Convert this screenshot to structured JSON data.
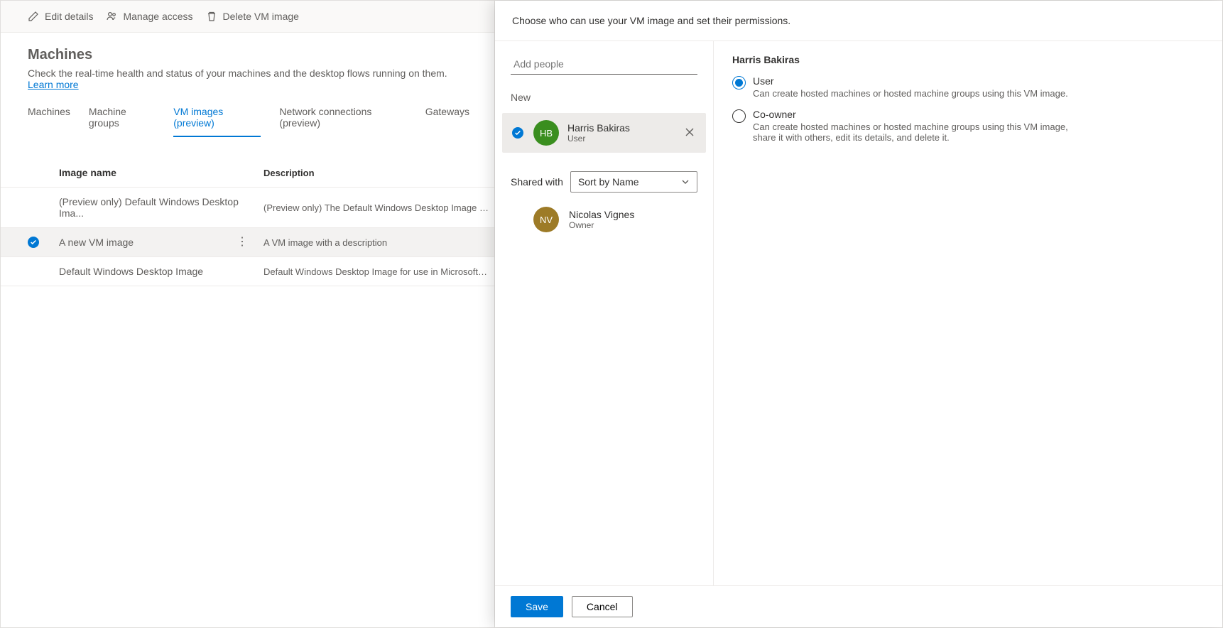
{
  "commandBar": {
    "edit": "Edit details",
    "manage": "Manage access",
    "delete": "Delete VM image"
  },
  "page": {
    "title": "Machines",
    "subtitle": "Check the real-time health and status of your machines and the desktop flows running on them. ",
    "learnMore": "Learn more"
  },
  "tabs": [
    {
      "label": "Machines"
    },
    {
      "label": "Machine groups"
    },
    {
      "label": "VM images (preview)",
      "active": true
    },
    {
      "label": "Network connections (preview)"
    },
    {
      "label": "Gateways"
    }
  ],
  "table": {
    "headers": {
      "name": "Image name",
      "desc": "Description"
    },
    "rows": [
      {
        "name": "(Preview only) Default Windows Desktop Ima...",
        "desc": "(Preview only) The Default Windows Desktop Image for use i...",
        "selected": false
      },
      {
        "name": "A new VM image",
        "desc": "A VM image with a description",
        "selected": true
      },
      {
        "name": "Default Windows Desktop Image",
        "desc": "Default Windows Desktop Image for use in Microsoft Deskto...",
        "selected": false
      }
    ]
  },
  "panel": {
    "headerText": "Choose who can use your VM image and set their permissions.",
    "addPeoplePlaceholder": "Add people",
    "newLabel": "New",
    "sharedWithLabel": "Shared with",
    "sortByLabel": "Sort by Name",
    "newPeople": [
      {
        "initials": "HB",
        "name": "Harris Bakiras",
        "role": "User",
        "avatarColor": "green"
      }
    ],
    "sharedPeople": [
      {
        "initials": "NV",
        "name": "Nicolas Vignes",
        "role": "Owner",
        "avatarColor": "olive"
      }
    ],
    "permissions": {
      "title": "Harris Bakiras",
      "options": [
        {
          "id": "user",
          "label": "User",
          "desc": "Can create hosted machines or hosted machine groups using this VM image.",
          "checked": true
        },
        {
          "id": "coowner",
          "label": "Co-owner",
          "desc": "Can create hosted machines or hosted machine groups using this VM image, share it with others, edit its details, and delete it.",
          "checked": false
        }
      ]
    },
    "footer": {
      "save": "Save",
      "cancel": "Cancel"
    }
  }
}
